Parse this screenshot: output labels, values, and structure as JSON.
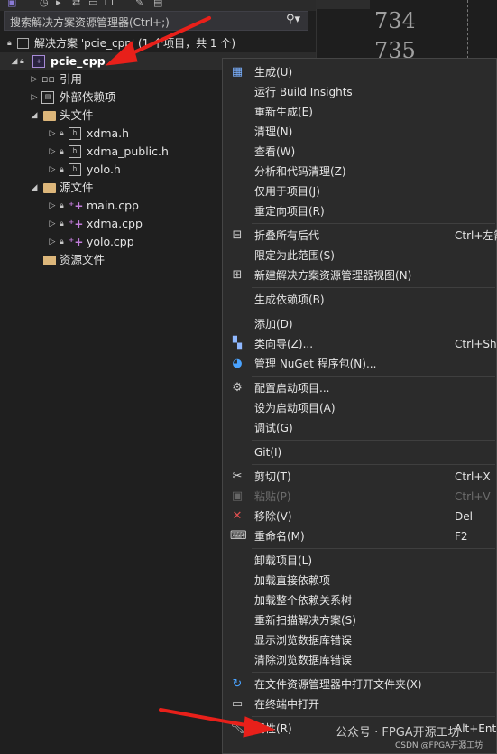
{
  "search": {
    "placeholder": "搜索解决方案资源管理器(Ctrl+;)",
    "icon": "search-icon"
  },
  "solution": {
    "label": "解决方案 'pcie_cpp' (1 个项目，共 1 个)"
  },
  "tree": [
    {
      "label": "pcie_cpp",
      "level": 0,
      "expanded": true,
      "icon": "project-icon",
      "lock": false,
      "bold": true
    },
    {
      "label": "引用",
      "level": 1,
      "expanded": false,
      "icon": "reference-icon"
    },
    {
      "label": "外部依赖项",
      "level": 1,
      "expanded": false,
      "icon": "dependency-icon"
    },
    {
      "label": "头文件",
      "level": 1,
      "expanded": true,
      "icon": "folder-icon"
    },
    {
      "label": "xdma.h",
      "level": 2,
      "expanded": false,
      "icon": "header-file-icon",
      "lock": true
    },
    {
      "label": "xdma_public.h",
      "level": 2,
      "expanded": false,
      "icon": "header-file-icon",
      "lock": true
    },
    {
      "label": "yolo.h",
      "level": 2,
      "expanded": false,
      "icon": "header-file-icon",
      "lock": true
    },
    {
      "label": "源文件",
      "level": 1,
      "expanded": true,
      "icon": "folder-icon"
    },
    {
      "label": "main.cpp",
      "level": 2,
      "expanded": false,
      "icon": "cpp-file-icon",
      "lock": true
    },
    {
      "label": "xdma.cpp",
      "level": 2,
      "expanded": false,
      "icon": "cpp-file-icon",
      "lock": true
    },
    {
      "label": "yolo.cpp",
      "level": 2,
      "expanded": false,
      "icon": "cpp-file-icon",
      "lock": true
    },
    {
      "label": "资源文件",
      "level": 1,
      "expanded": null,
      "icon": "folder-icon"
    }
  ],
  "editor": {
    "line_numbers": [
      "734",
      "735"
    ]
  },
  "menu": {
    "items": [
      {
        "label": "生成(U)",
        "shortcut": "",
        "icon": "build-icon"
      },
      {
        "label": "运行 Build Insights",
        "shortcut": "",
        "icon": ""
      },
      {
        "label": "重新生成(E)",
        "shortcut": "",
        "icon": ""
      },
      {
        "label": "清理(N)",
        "shortcut": "",
        "icon": ""
      },
      {
        "label": "查看(W)",
        "shortcut": "",
        "icon": ""
      },
      {
        "label": "分析和代码清理(Z)",
        "shortcut": "",
        "icon": ""
      },
      {
        "label": "仅用于项目(J)",
        "shortcut": "",
        "icon": ""
      },
      {
        "label": "重定向项目(R)",
        "shortcut": "",
        "icon": ""
      },
      {
        "label": "折叠所有后代",
        "shortcut": "Ctrl+左箭",
        "icon": "collapse-icon",
        "sep_before": true
      },
      {
        "label": "限定为此范围(S)",
        "shortcut": "",
        "icon": ""
      },
      {
        "label": "新建解决方案资源管理器视图(N)",
        "shortcut": "",
        "icon": "new-view-icon"
      },
      {
        "label": "生成依赖项(B)",
        "shortcut": "",
        "icon": "",
        "sep_before": true
      },
      {
        "label": "添加(D)",
        "shortcut": "",
        "icon": "",
        "sep_before": true
      },
      {
        "label": "类向导(Z)...",
        "shortcut": "Ctrl+Shif",
        "icon": "class-wizard-icon"
      },
      {
        "label": "管理 NuGet 程序包(N)...",
        "shortcut": "",
        "icon": "nuget-icon"
      },
      {
        "label": "配置启动项目...",
        "shortcut": "",
        "icon": "gear-icon",
        "sep_before": true
      },
      {
        "label": "设为启动项目(A)",
        "shortcut": "",
        "icon": ""
      },
      {
        "label": "调试(G)",
        "shortcut": "",
        "icon": ""
      },
      {
        "label": "Git(I)",
        "shortcut": "",
        "icon": "",
        "sep_before": true
      },
      {
        "label": "剪切(T)",
        "shortcut": "Ctrl+X",
        "icon": "cut-icon",
        "sep_before": true
      },
      {
        "label": "粘贴(P)",
        "shortcut": "Ctrl+V",
        "icon": "paste-icon",
        "disabled": true
      },
      {
        "label": "移除(V)",
        "shortcut": "Del",
        "icon": "remove-icon"
      },
      {
        "label": "重命名(M)",
        "shortcut": "F2",
        "icon": "rename-icon"
      },
      {
        "label": "卸载项目(L)",
        "shortcut": "",
        "icon": "",
        "sep_before": true
      },
      {
        "label": "加载直接依赖项",
        "shortcut": "",
        "icon": ""
      },
      {
        "label": "加载整个依赖关系树",
        "shortcut": "",
        "icon": ""
      },
      {
        "label": "重新扫描解决方案(S)",
        "shortcut": "",
        "icon": ""
      },
      {
        "label": "显示浏览数据库错误",
        "shortcut": "",
        "icon": ""
      },
      {
        "label": "清除浏览数据库错误",
        "shortcut": "",
        "icon": ""
      },
      {
        "label": "在文件资源管理器中打开文件夹(X)",
        "shortcut": "",
        "icon": "open-folder-icon",
        "sep_before": true
      },
      {
        "label": "在终端中打开",
        "shortcut": "",
        "icon": "terminal-icon"
      },
      {
        "label": "属性(R)",
        "shortcut": "Alt+Ente",
        "icon": "wrench-icon",
        "sep_before": true
      }
    ]
  },
  "watermark": {
    "line1": "公众号 · FPGA开源工坊",
    "line2": "CSDN @FPGA开源工坊"
  },
  "colors": {
    "menu_bg": "#2b2b2b",
    "panel_bg": "#1f1f1f",
    "arrow": "#e8201a",
    "folder": "#dcb67a"
  }
}
